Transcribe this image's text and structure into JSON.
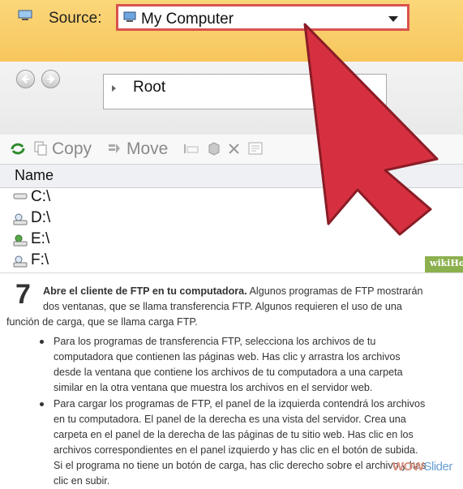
{
  "source": {
    "label": "Source:",
    "selected": "My Computer"
  },
  "nav": {
    "path": "Root"
  },
  "toolbar": {
    "copy_label": "Copy",
    "move_label": "Move"
  },
  "file_list": {
    "header": "Name",
    "drives": [
      {
        "name": "C:\\",
        "icon": "hard-drive-icon"
      },
      {
        "name": "D:\\",
        "icon": "network-drive-icon"
      },
      {
        "name": "E:\\",
        "icon": "network-drive-icon"
      },
      {
        "name": "F:\\",
        "icon": "network-drive-icon"
      }
    ]
  },
  "branding": {
    "wiki_tag": "wikiHow",
    "watermark_a": "WOW",
    "watermark_b": "Slider"
  },
  "step": {
    "number": "7",
    "lead_bold": "Abre el cliente de FTP en tu computadora.",
    "lead_rest": " Algunos programas de FTP mostrarán",
    "line2": "dos ventanas, que se llama transferencia FTP. Algunos requieren el uso de una",
    "line3": "función de carga, que se llama carga FTP.",
    "bullets": [
      {
        "lines": [
          "Para los programas de transferencia FTP, selecciona los archivos de tu",
          "computadora que contienen las páginas web. Has clic y arrastra los archivos",
          "desde la ventana que contiene los archivos de tu computadora a una carpeta",
          "similar en la otra ventana que muestra los archivos en el servidor web."
        ]
      },
      {
        "lines": [
          "Para cargar los programas de FTP, el panel de la izquierda contendrá los archivos",
          "en tu computadora. El panel de la derecha es una vista del servidor. Crea una",
          "carpeta en el panel de la derecha de las páginas de tu sitio web. Has clic en los",
          "archivos correspondientes en el panel izquierdo y has clic en el botón de subida.",
          "Si el programa no tiene un botón de carga, has clic derecho sobre el archivo y has",
          "clic en subir."
        ]
      }
    ]
  },
  "colors": {
    "source_bar": "#f7c65c",
    "highlight_border": "#d9534f",
    "arrow_fill": "#d63040",
    "wiki_green": "#8cb04e"
  }
}
